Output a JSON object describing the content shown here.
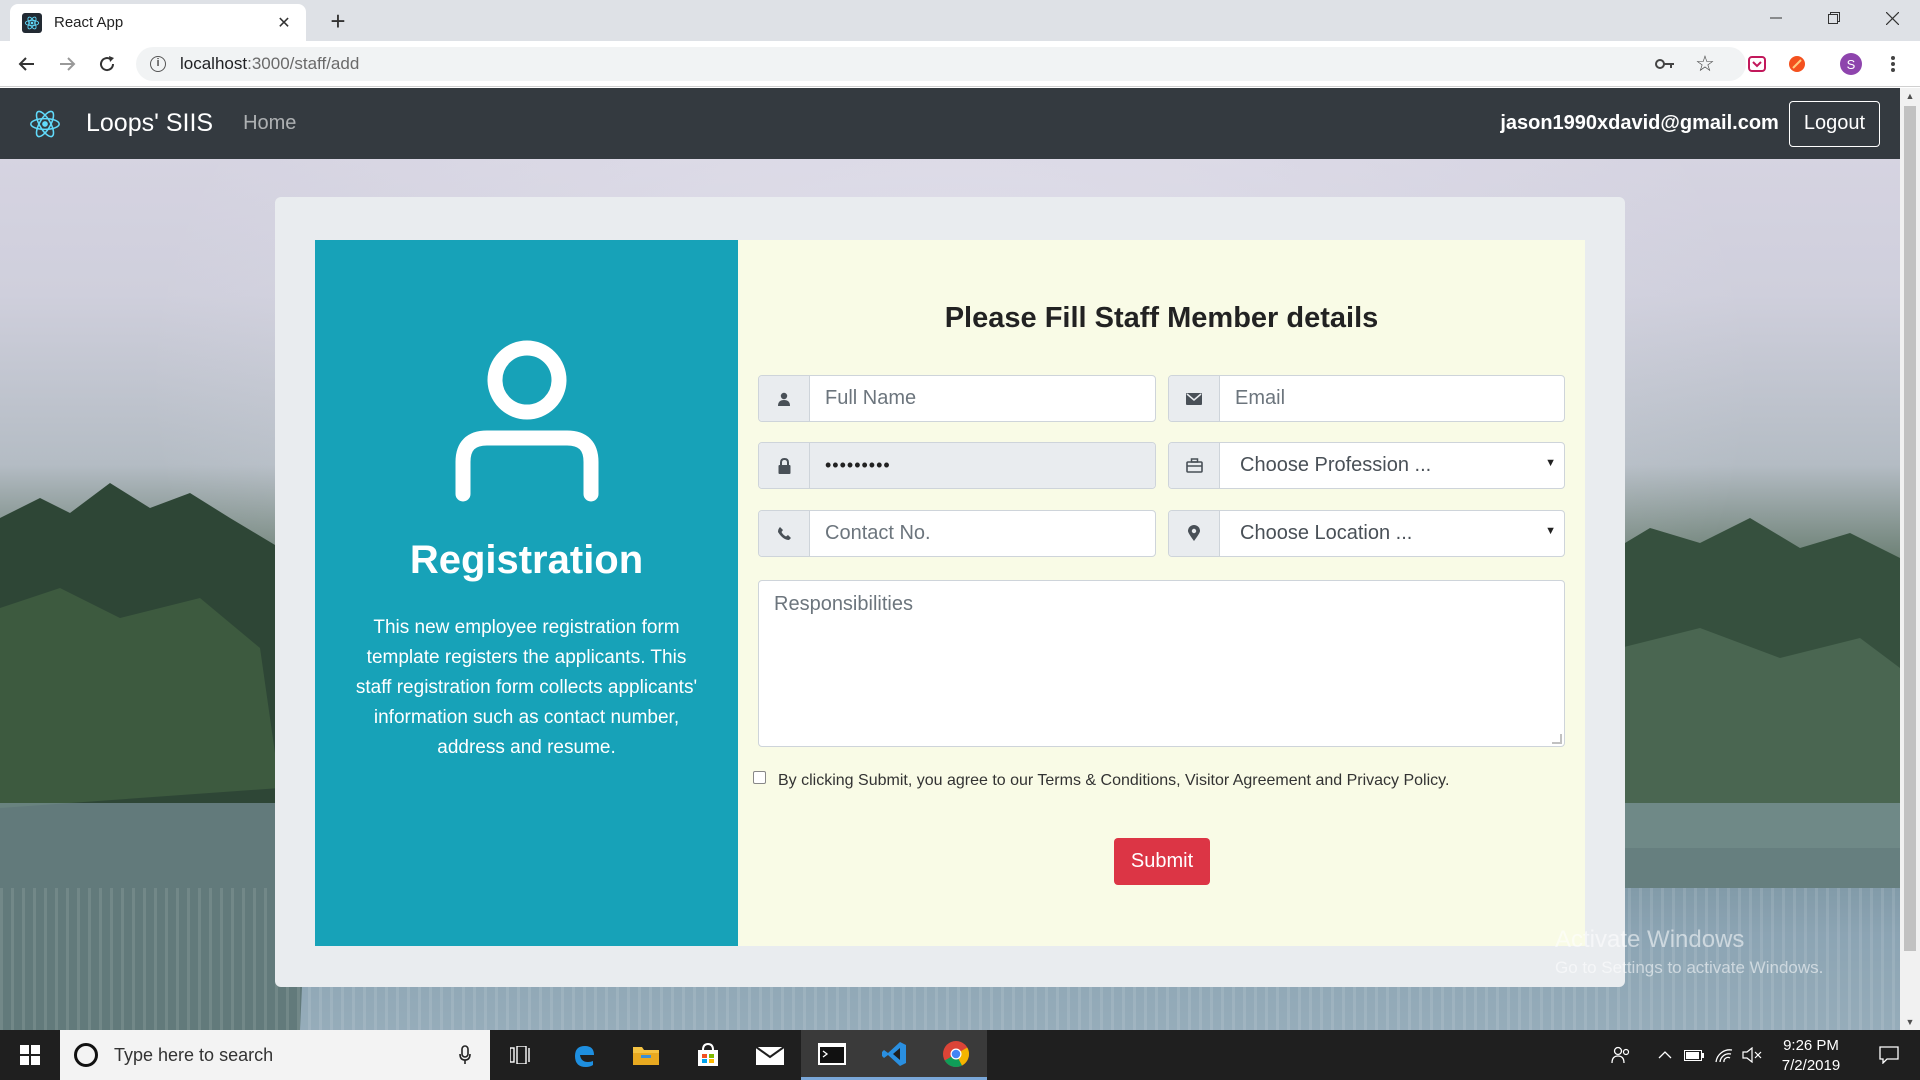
{
  "browser": {
    "tab_title": "React App",
    "url_host": "localhost",
    "url_rest": ":3000/staff/add"
  },
  "app": {
    "brand": "Loops' SIIS",
    "nav_home": "Home",
    "user_email": "jason1990xdavid@gmail.com",
    "logout": "Logout"
  },
  "left_panel": {
    "title": "Registration",
    "description": "This new employee registration form template registers the applicants. This staff registration form collects applicants' information such as contact number, address and resume."
  },
  "form": {
    "title": "Please Fill Staff Member details",
    "full_name_placeholder": "Full Name",
    "email_placeholder": "Email",
    "password_value": "•••••••••",
    "profession_selected": "Choose Profession ...",
    "contact_placeholder": "Contact No.",
    "location_selected": "Choose Location ...",
    "responsibilities_placeholder": "Responsibilities",
    "agreement": "By clicking Submit, you agree to our Terms & Conditions, Visitor Agreement and Privacy Policy.",
    "submit": "Submit"
  },
  "watermark": {
    "line1": "Activate Windows",
    "line2": "Go to Settings to activate Windows."
  },
  "taskbar": {
    "search_placeholder": "Type here to search",
    "time": "9:26 PM",
    "date": "7/2/2019"
  },
  "colors": {
    "navbar": "#343a40",
    "left_panel": "#17a2b8",
    "right_panel": "#f9fbe6",
    "submit": "#dc3545"
  }
}
